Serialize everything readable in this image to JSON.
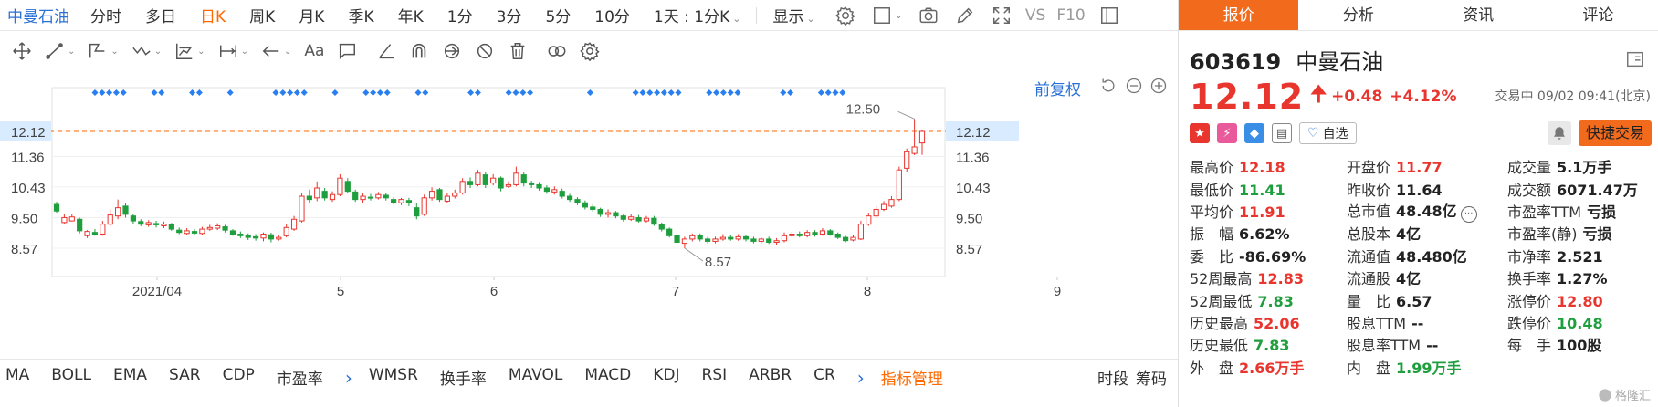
{
  "toolbar": {
    "brand": "中曼石油",
    "periods": [
      "分时",
      "多日",
      "日K",
      "周K",
      "月K",
      "季K",
      "年K",
      "1分",
      "3分",
      "5分",
      "10分"
    ],
    "active_period": "日K",
    "interval_select": "1天 : 1分K",
    "display_label": "显示",
    "vs_label": "VS",
    "f10_label": "F10"
  },
  "draw_toolbar": {
    "text_tool": "Aa"
  },
  "chart": {
    "restore_label": "前复权",
    "price_marker": "12.12",
    "high_annot": "12.50",
    "low_annot": "8.57",
    "accent_color": "#ff6a00",
    "up_color": "#e8352e",
    "down_color": "#1e9e3c",
    "marker_color": "#2a7ff0"
  },
  "chart_data": {
    "type": "candlestick",
    "y_ticks": [
      "12.12",
      "11.36",
      "10.43",
      "9.50",
      "8.57"
    ],
    "ylim": [
      7.9,
      13.0
    ],
    "x_ticks": [
      "2021/04",
      "5",
      "6",
      "7",
      "8",
      "9"
    ],
    "last_price": 12.12,
    "high_marker": 12.5,
    "low_marker": 8.57,
    "series": [
      {
        "o": 9.9,
        "c": 9.7,
        "h": 9.98,
        "l": 9.65
      },
      {
        "o": 9.35,
        "c": 9.5,
        "h": 9.62,
        "l": 9.3
      },
      {
        "o": 9.4,
        "c": 9.52,
        "h": 9.6,
        "l": 9.38
      },
      {
        "o": 9.45,
        "c": 9.1,
        "h": 9.5,
        "l": 9.02
      },
      {
        "o": 8.95,
        "c": 9.08,
        "h": 9.12,
        "l": 8.88
      },
      {
        "o": 9.05,
        "c": 9.0,
        "h": 9.15,
        "l": 8.95
      },
      {
        "o": 9.0,
        "c": 9.3,
        "h": 9.4,
        "l": 8.95
      },
      {
        "o": 9.3,
        "c": 9.58,
        "h": 9.75,
        "l": 9.25
      },
      {
        "o": 9.55,
        "c": 9.8,
        "h": 10.05,
        "l": 9.45
      },
      {
        "o": 9.85,
        "c": 9.6,
        "h": 9.95,
        "l": 9.5
      },
      {
        "o": 9.55,
        "c": 9.4,
        "h": 9.62,
        "l": 9.32
      },
      {
        "o": 9.38,
        "c": 9.3,
        "h": 9.45,
        "l": 9.24
      },
      {
        "o": 9.28,
        "c": 9.35,
        "h": 9.42,
        "l": 9.22
      },
      {
        "o": 9.32,
        "c": 9.28,
        "h": 9.4,
        "l": 9.2
      },
      {
        "o": 9.25,
        "c": 9.3,
        "h": 9.38,
        "l": 9.18
      },
      {
        "o": 9.28,
        "c": 9.15,
        "h": 9.34,
        "l": 9.1
      },
      {
        "o": 9.12,
        "c": 9.05,
        "h": 9.2,
        "l": 9.0
      },
      {
        "o": 9.02,
        "c": 9.1,
        "h": 9.18,
        "l": 8.98
      },
      {
        "o": 9.08,
        "c": 9.03,
        "h": 9.15,
        "l": 8.97
      },
      {
        "o": 9.02,
        "c": 9.15,
        "h": 9.22,
        "l": 8.98
      },
      {
        "o": 9.15,
        "c": 9.2,
        "h": 9.28,
        "l": 9.1
      },
      {
        "o": 9.18,
        "c": 9.25,
        "h": 9.33,
        "l": 9.12
      },
      {
        "o": 9.22,
        "c": 9.12,
        "h": 9.28,
        "l": 9.05
      },
      {
        "o": 9.1,
        "c": 9.0,
        "h": 9.15,
        "l": 8.95
      },
      {
        "o": 9.0,
        "c": 8.95,
        "h": 9.08,
        "l": 8.88
      },
      {
        "o": 8.95,
        "c": 8.9,
        "h": 9.02,
        "l": 8.82
      },
      {
        "o": 8.92,
        "c": 8.88,
        "h": 9.0,
        "l": 8.8
      },
      {
        "o": 8.88,
        "c": 9.0,
        "h": 9.05,
        "l": 8.78
      },
      {
        "o": 8.98,
        "c": 8.85,
        "h": 9.04,
        "l": 8.75
      },
      {
        "o": 8.85,
        "c": 8.9,
        "h": 8.98,
        "l": 8.8
      },
      {
        "o": 8.95,
        "c": 9.2,
        "h": 9.3,
        "l": 8.9
      },
      {
        "o": 9.15,
        "c": 9.45,
        "h": 9.55,
        "l": 9.1
      },
      {
        "o": 9.4,
        "c": 10.15,
        "h": 10.25,
        "l": 9.35
      },
      {
        "o": 10.15,
        "c": 10.05,
        "h": 10.35,
        "l": 9.95
      },
      {
        "o": 10.1,
        "c": 10.4,
        "h": 10.6,
        "l": 10.0
      },
      {
        "o": 10.3,
        "c": 10.1,
        "h": 10.4,
        "l": 10.02
      },
      {
        "o": 10.05,
        "c": 10.2,
        "h": 10.3,
        "l": 9.98
      },
      {
        "o": 10.2,
        "c": 10.7,
        "h": 10.82,
        "l": 10.15
      },
      {
        "o": 10.6,
        "c": 10.3,
        "h": 10.7,
        "l": 10.25
      },
      {
        "o": 10.28,
        "c": 10.05,
        "h": 10.35,
        "l": 9.98
      },
      {
        "o": 10.05,
        "c": 10.15,
        "h": 10.25,
        "l": 9.95
      },
      {
        "o": 10.12,
        "c": 10.1,
        "h": 10.22,
        "l": 10.02
      },
      {
        "o": 10.1,
        "c": 10.2,
        "h": 10.28,
        "l": 10.05
      },
      {
        "o": 10.18,
        "c": 10.1,
        "h": 10.25,
        "l": 10.02
      },
      {
        "o": 10.05,
        "c": 9.95,
        "h": 10.12,
        "l": 9.9
      },
      {
        "o": 9.95,
        "c": 10.05,
        "h": 10.1,
        "l": 9.88
      },
      {
        "o": 10.02,
        "c": 9.95,
        "h": 10.1,
        "l": 9.85
      },
      {
        "o": 9.8,
        "c": 9.55,
        "h": 9.95,
        "l": 9.45
      },
      {
        "o": 9.6,
        "c": 10.1,
        "h": 10.2,
        "l": 9.55
      },
      {
        "o": 10.1,
        "c": 10.3,
        "h": 10.42,
        "l": 10.02
      },
      {
        "o": 10.35,
        "c": 10.05,
        "h": 10.4,
        "l": 9.98
      },
      {
        "o": 10.0,
        "c": 10.15,
        "h": 10.25,
        "l": 9.95
      },
      {
        "o": 10.15,
        "c": 10.25,
        "h": 10.35,
        "l": 10.08
      },
      {
        "o": 10.25,
        "c": 10.6,
        "h": 10.7,
        "l": 10.2
      },
      {
        "o": 10.6,
        "c": 10.5,
        "h": 10.72,
        "l": 10.4
      },
      {
        "o": 10.5,
        "c": 10.85,
        "h": 10.95,
        "l": 10.45
      },
      {
        "o": 10.8,
        "c": 10.5,
        "h": 10.9,
        "l": 10.4
      },
      {
        "o": 10.55,
        "c": 10.7,
        "h": 10.82,
        "l": 10.48
      },
      {
        "o": 10.7,
        "c": 10.4,
        "h": 10.75,
        "l": 10.3
      },
      {
        "o": 10.45,
        "c": 10.5,
        "h": 10.6,
        "l": 10.4
      },
      {
        "o": 10.5,
        "c": 10.85,
        "h": 11.05,
        "l": 10.45
      },
      {
        "o": 10.8,
        "c": 10.55,
        "h": 10.9,
        "l": 10.45
      },
      {
        "o": 10.55,
        "c": 10.5,
        "h": 10.62,
        "l": 10.4
      },
      {
        "o": 10.5,
        "c": 10.4,
        "h": 10.58,
        "l": 10.32
      },
      {
        "o": 10.4,
        "c": 10.3,
        "h": 10.48,
        "l": 10.22
      },
      {
        "o": 10.28,
        "c": 10.35,
        "h": 10.45,
        "l": 10.2
      },
      {
        "o": 10.3,
        "c": 10.15,
        "h": 10.38,
        "l": 10.08
      },
      {
        "o": 10.15,
        "c": 10.05,
        "h": 10.22,
        "l": 9.98
      },
      {
        "o": 10.05,
        "c": 9.95,
        "h": 10.12,
        "l": 9.88
      },
      {
        "o": 9.95,
        "c": 9.82,
        "h": 10.02,
        "l": 9.75
      },
      {
        "o": 9.82,
        "c": 9.75,
        "h": 9.9,
        "l": 9.68
      },
      {
        "o": 9.75,
        "c": 9.6,
        "h": 9.8,
        "l": 9.52
      },
      {
        "o": 9.6,
        "c": 9.65,
        "h": 9.75,
        "l": 9.5
      },
      {
        "o": 9.65,
        "c": 9.55,
        "h": 9.7,
        "l": 9.48
      },
      {
        "o": 9.55,
        "c": 9.45,
        "h": 9.62,
        "l": 9.38
      },
      {
        "o": 9.45,
        "c": 9.52,
        "h": 9.6,
        "l": 9.4
      },
      {
        "o": 9.5,
        "c": 9.4,
        "h": 9.58,
        "l": 9.35
      },
      {
        "o": 9.4,
        "c": 9.48,
        "h": 9.55,
        "l": 9.35
      },
      {
        "o": 9.48,
        "c": 9.3,
        "h": 9.55,
        "l": 9.25
      },
      {
        "o": 9.3,
        "c": 9.15,
        "h": 9.35,
        "l": 9.08
      },
      {
        "o": 9.15,
        "c": 8.95,
        "h": 9.2,
        "l": 8.9
      },
      {
        "o": 8.95,
        "c": 8.75,
        "h": 9.0,
        "l": 8.7
      },
      {
        "o": 8.72,
        "c": 8.85,
        "h": 8.92,
        "l": 8.57
      },
      {
        "o": 8.85,
        "c": 8.95,
        "h": 9.02,
        "l": 8.78
      },
      {
        "o": 8.95,
        "c": 8.85,
        "h": 9.02,
        "l": 8.78
      },
      {
        "o": 8.85,
        "c": 8.78,
        "h": 8.92,
        "l": 8.72
      },
      {
        "o": 8.78,
        "c": 8.85,
        "h": 8.92,
        "l": 8.72
      },
      {
        "o": 8.85,
        "c": 8.9,
        "h": 9.0,
        "l": 8.8
      },
      {
        "o": 8.9,
        "c": 8.85,
        "h": 8.98,
        "l": 8.8
      },
      {
        "o": 8.85,
        "c": 8.92,
        "h": 9.0,
        "l": 8.8
      },
      {
        "o": 8.92,
        "c": 8.85,
        "h": 8.98,
        "l": 8.78
      },
      {
        "o": 8.85,
        "c": 8.78,
        "h": 8.92,
        "l": 8.72
      },
      {
        "o": 8.78,
        "c": 8.85,
        "h": 8.9,
        "l": 8.72
      },
      {
        "o": 8.85,
        "c": 8.75,
        "h": 8.92,
        "l": 8.7
      },
      {
        "o": 8.75,
        "c": 8.8,
        "h": 8.88,
        "l": 8.68
      },
      {
        "o": 8.8,
        "c": 8.95,
        "h": 9.05,
        "l": 8.75
      },
      {
        "o": 8.95,
        "c": 9.0,
        "h": 9.08,
        "l": 8.9
      },
      {
        "o": 9.0,
        "c": 8.95,
        "h": 9.08,
        "l": 8.9
      },
      {
        "o": 8.95,
        "c": 9.05,
        "h": 9.12,
        "l": 8.9
      },
      {
        "o": 9.05,
        "c": 8.98,
        "h": 9.12,
        "l": 8.92
      },
      {
        "o": 9.0,
        "c": 9.1,
        "h": 9.18,
        "l": 8.95
      },
      {
        "o": 9.1,
        "c": 9.0,
        "h": 9.15,
        "l": 8.95
      },
      {
        "o": 9.0,
        "c": 8.9,
        "h": 9.05,
        "l": 8.85
      },
      {
        "o": 8.9,
        "c": 8.8,
        "h": 8.95,
        "l": 8.75
      },
      {
        "o": 8.82,
        "c": 8.9,
        "h": 8.98,
        "l": 8.78
      },
      {
        "o": 8.85,
        "c": 9.3,
        "h": 9.4,
        "l": 8.82
      },
      {
        "o": 9.3,
        "c": 9.55,
        "h": 9.65,
        "l": 9.25
      },
      {
        "o": 9.55,
        "c": 9.75,
        "h": 9.85,
        "l": 9.5
      },
      {
        "o": 9.75,
        "c": 9.9,
        "h": 10.0,
        "l": 9.7
      },
      {
        "o": 9.85,
        "c": 10.05,
        "h": 10.15,
        "l": 9.8
      },
      {
        "o": 10.05,
        "c": 10.95,
        "h": 11.05,
        "l": 10.0
      },
      {
        "o": 11.0,
        "c": 11.5,
        "h": 11.6,
        "l": 10.9
      },
      {
        "o": 11.45,
        "c": 11.65,
        "h": 12.5,
        "l": 11.4
      },
      {
        "o": 11.77,
        "c": 12.12,
        "h": 12.18,
        "l": 11.41
      }
    ],
    "marker_groups": [
      5,
      0,
      2,
      0,
      2,
      0,
      1,
      0,
      0,
      5,
      0,
      1,
      0,
      4,
      0,
      2,
      0,
      0,
      2,
      0,
      4,
      0,
      0,
      0,
      1,
      0,
      0,
      7,
      0,
      5,
      0,
      0,
      2,
      0,
      4
    ]
  },
  "indicators": {
    "items": [
      "MA",
      "BOLL",
      "EMA",
      "SAR",
      "CDP",
      "市盈率"
    ],
    "items2": [
      "WMSR",
      "换手率",
      "MAVOL",
      "MACD",
      "KDJ",
      "RSI",
      "ARBR",
      "CR"
    ],
    "manager": "指标管理",
    "right": [
      "时段",
      "筹码"
    ]
  },
  "panel": {
    "tabs": [
      "报价",
      "分析",
      "资讯",
      "评论"
    ],
    "code": "603619",
    "name": "中曼石油",
    "price": "12.12",
    "change": "+0.48",
    "change_pct": "+4.12%",
    "trade_status": "交易中 09/02 09:41(北京)",
    "watch_label": "自选",
    "quick_trade": "快捷交易",
    "stats": [
      [
        [
          "最高价",
          "12.18",
          "red"
        ],
        [
          "开盘价",
          "11.77",
          "red"
        ],
        [
          "成交量",
          "5.1万手",
          ""
        ]
      ],
      [
        [
          "最低价",
          "11.41",
          "green"
        ],
        [
          "昨收价",
          "11.64",
          ""
        ],
        [
          "成交额",
          "6071.47万",
          ""
        ]
      ],
      [
        [
          "平均价",
          "11.91",
          "red"
        ],
        [
          "总市值",
          "48.48亿",
          ""
        ],
        [
          "市盈率TTM",
          "亏损",
          ""
        ]
      ],
      [
        [
          "振　幅",
          "6.62%",
          ""
        ],
        [
          "总股本",
          "4亿",
          ""
        ],
        [
          "市盈率(静)",
          "亏损",
          ""
        ]
      ],
      [
        [
          "委　比",
          "-86.69%",
          ""
        ],
        [
          "流通值",
          "48.480亿",
          ""
        ],
        [
          "市净率",
          "2.521",
          ""
        ]
      ],
      [
        [
          "52周最高",
          "12.83",
          "red"
        ],
        [
          "流通股",
          "4亿",
          ""
        ],
        [
          "换手率",
          "1.27%",
          ""
        ]
      ],
      [
        [
          "52周最低",
          "7.83",
          "green"
        ],
        [
          "量　比",
          "6.57",
          ""
        ],
        [
          "涨停价",
          "12.80",
          "red"
        ]
      ],
      [
        [
          "历史最高",
          "52.06",
          "red"
        ],
        [
          "股息TTM",
          "--",
          ""
        ],
        [
          "跌停价",
          "10.48",
          "green"
        ]
      ],
      [
        [
          "历史最低",
          "7.83",
          "green"
        ],
        [
          "股息率TTM",
          "--",
          ""
        ],
        [
          "每　手",
          "100股",
          ""
        ]
      ],
      [
        [
          "外　盘",
          "2.66万手",
          "red"
        ],
        [
          "内　盘",
          "1.99万手",
          "green"
        ],
        [
          "",
          "",
          " "
        ]
      ]
    ],
    "watermark": "格隆汇"
  }
}
